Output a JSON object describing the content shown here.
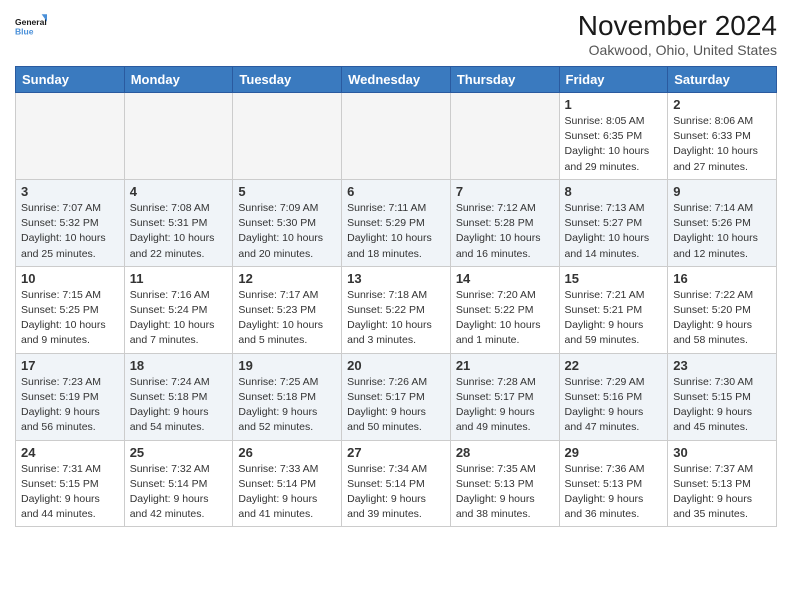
{
  "app": {
    "name": "GeneralBlue",
    "logo_color": "Blue"
  },
  "header": {
    "title": "November 2024",
    "location": "Oakwood, Ohio, United States"
  },
  "weekdays": [
    "Sunday",
    "Monday",
    "Tuesday",
    "Wednesday",
    "Thursday",
    "Friday",
    "Saturday"
  ],
  "weeks": [
    [
      {
        "day": "",
        "empty": true
      },
      {
        "day": "",
        "empty": true
      },
      {
        "day": "",
        "empty": true
      },
      {
        "day": "",
        "empty": true
      },
      {
        "day": "",
        "empty": true
      },
      {
        "day": "1",
        "info": "Sunrise: 8:05 AM\nSunset: 6:35 PM\nDaylight: 10 hours\nand 29 minutes."
      },
      {
        "day": "2",
        "info": "Sunrise: 8:06 AM\nSunset: 6:33 PM\nDaylight: 10 hours\nand 27 minutes."
      }
    ],
    [
      {
        "day": "3",
        "info": "Sunrise: 7:07 AM\nSunset: 5:32 PM\nDaylight: 10 hours\nand 25 minutes."
      },
      {
        "day": "4",
        "info": "Sunrise: 7:08 AM\nSunset: 5:31 PM\nDaylight: 10 hours\nand 22 minutes."
      },
      {
        "day": "5",
        "info": "Sunrise: 7:09 AM\nSunset: 5:30 PM\nDaylight: 10 hours\nand 20 minutes."
      },
      {
        "day": "6",
        "info": "Sunrise: 7:11 AM\nSunset: 5:29 PM\nDaylight: 10 hours\nand 18 minutes."
      },
      {
        "day": "7",
        "info": "Sunrise: 7:12 AM\nSunset: 5:28 PM\nDaylight: 10 hours\nand 16 minutes."
      },
      {
        "day": "8",
        "info": "Sunrise: 7:13 AM\nSunset: 5:27 PM\nDaylight: 10 hours\nand 14 minutes."
      },
      {
        "day": "9",
        "info": "Sunrise: 7:14 AM\nSunset: 5:26 PM\nDaylight: 10 hours\nand 12 minutes."
      }
    ],
    [
      {
        "day": "10",
        "info": "Sunrise: 7:15 AM\nSunset: 5:25 PM\nDaylight: 10 hours\nand 9 minutes."
      },
      {
        "day": "11",
        "info": "Sunrise: 7:16 AM\nSunset: 5:24 PM\nDaylight: 10 hours\nand 7 minutes."
      },
      {
        "day": "12",
        "info": "Sunrise: 7:17 AM\nSunset: 5:23 PM\nDaylight: 10 hours\nand 5 minutes."
      },
      {
        "day": "13",
        "info": "Sunrise: 7:18 AM\nSunset: 5:22 PM\nDaylight: 10 hours\nand 3 minutes."
      },
      {
        "day": "14",
        "info": "Sunrise: 7:20 AM\nSunset: 5:22 PM\nDaylight: 10 hours\nand 1 minute."
      },
      {
        "day": "15",
        "info": "Sunrise: 7:21 AM\nSunset: 5:21 PM\nDaylight: 9 hours\nand 59 minutes."
      },
      {
        "day": "16",
        "info": "Sunrise: 7:22 AM\nSunset: 5:20 PM\nDaylight: 9 hours\nand 58 minutes."
      }
    ],
    [
      {
        "day": "17",
        "info": "Sunrise: 7:23 AM\nSunset: 5:19 PM\nDaylight: 9 hours\nand 56 minutes."
      },
      {
        "day": "18",
        "info": "Sunrise: 7:24 AM\nSunset: 5:18 PM\nDaylight: 9 hours\nand 54 minutes."
      },
      {
        "day": "19",
        "info": "Sunrise: 7:25 AM\nSunset: 5:18 PM\nDaylight: 9 hours\nand 52 minutes."
      },
      {
        "day": "20",
        "info": "Sunrise: 7:26 AM\nSunset: 5:17 PM\nDaylight: 9 hours\nand 50 minutes."
      },
      {
        "day": "21",
        "info": "Sunrise: 7:28 AM\nSunset: 5:17 PM\nDaylight: 9 hours\nand 49 minutes."
      },
      {
        "day": "22",
        "info": "Sunrise: 7:29 AM\nSunset: 5:16 PM\nDaylight: 9 hours\nand 47 minutes."
      },
      {
        "day": "23",
        "info": "Sunrise: 7:30 AM\nSunset: 5:15 PM\nDaylight: 9 hours\nand 45 minutes."
      }
    ],
    [
      {
        "day": "24",
        "info": "Sunrise: 7:31 AM\nSunset: 5:15 PM\nDaylight: 9 hours\nand 44 minutes."
      },
      {
        "day": "25",
        "info": "Sunrise: 7:32 AM\nSunset: 5:14 PM\nDaylight: 9 hours\nand 42 minutes."
      },
      {
        "day": "26",
        "info": "Sunrise: 7:33 AM\nSunset: 5:14 PM\nDaylight: 9 hours\nand 41 minutes."
      },
      {
        "day": "27",
        "info": "Sunrise: 7:34 AM\nSunset: 5:14 PM\nDaylight: 9 hours\nand 39 minutes."
      },
      {
        "day": "28",
        "info": "Sunrise: 7:35 AM\nSunset: 5:13 PM\nDaylight: 9 hours\nand 38 minutes."
      },
      {
        "day": "29",
        "info": "Sunrise: 7:36 AM\nSunset: 5:13 PM\nDaylight: 9 hours\nand 36 minutes."
      },
      {
        "day": "30",
        "info": "Sunrise: 7:37 AM\nSunset: 5:13 PM\nDaylight: 9 hours\nand 35 minutes."
      }
    ]
  ]
}
